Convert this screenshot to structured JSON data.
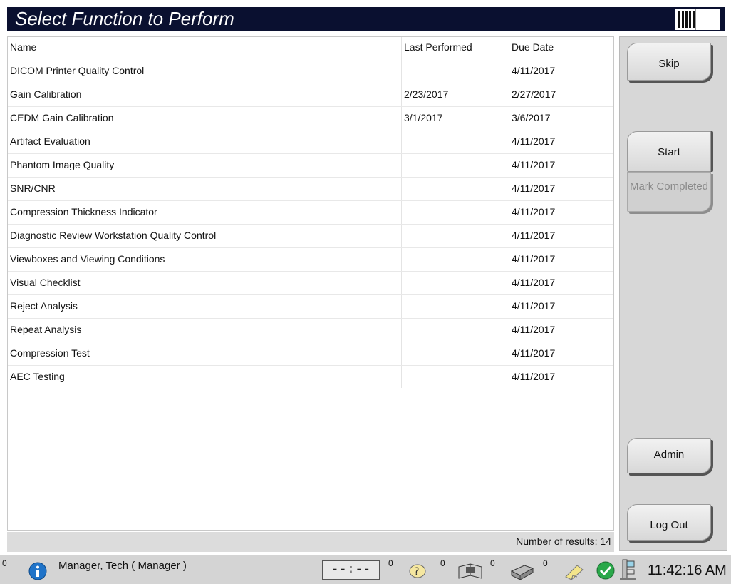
{
  "window": {
    "title": "Select Function to Perform"
  },
  "table": {
    "columns": [
      "Name",
      "Last Performed",
      "Due Date"
    ],
    "rows": [
      {
        "name": "DICOM Printer Quality Control",
        "last_performed": "",
        "due_date": "4/11/2017"
      },
      {
        "name": "Gain Calibration",
        "last_performed": "2/23/2017",
        "due_date": "2/27/2017"
      },
      {
        "name": "CEDM Gain Calibration",
        "last_performed": "3/1/2017",
        "due_date": "3/6/2017"
      },
      {
        "name": "Artifact Evaluation",
        "last_performed": "",
        "due_date": "4/11/2017"
      },
      {
        "name": "Phantom Image Quality",
        "last_performed": "",
        "due_date": "4/11/2017"
      },
      {
        "name": "SNR/CNR",
        "last_performed": "",
        "due_date": "4/11/2017"
      },
      {
        "name": "Compression Thickness Indicator",
        "last_performed": "",
        "due_date": "4/11/2017"
      },
      {
        "name": "Diagnostic Review Workstation Quality Control",
        "last_performed": "",
        "due_date": "4/11/2017"
      },
      {
        "name": "Viewboxes and Viewing Conditions",
        "last_performed": "",
        "due_date": "4/11/2017"
      },
      {
        "name": "Visual Checklist",
        "last_performed": "",
        "due_date": "4/11/2017"
      },
      {
        "name": "Reject Analysis",
        "last_performed": "",
        "due_date": "4/11/2017"
      },
      {
        "name": "Repeat Analysis",
        "last_performed": "",
        "due_date": "4/11/2017"
      },
      {
        "name": "Compression Test",
        "last_performed": "",
        "due_date": "4/11/2017"
      },
      {
        "name": "AEC Testing",
        "last_performed": "",
        "due_date": "4/11/2017"
      }
    ],
    "results_label": "Number of results: 14"
  },
  "buttons": {
    "skip": "Skip",
    "start": "Start",
    "mark_completed": "Mark Completed",
    "admin": "Admin",
    "logout": "Log Out"
  },
  "taskbar": {
    "info_count": "0",
    "user": "Manager, Tech ( Manager )",
    "timer": "--:--",
    "count_after_timer": "0",
    "count_after_help": "0",
    "count_after_book": "0",
    "count_after_printer": "0",
    "time": "11:42:16 AM",
    "icons": [
      "info-icon",
      "help-icon",
      "book-icon",
      "printer-icon",
      "note-icon",
      "check-icon",
      "device-icon"
    ]
  },
  "colors": {
    "title_bar": "#0a1030",
    "panel": "#d7d7d7",
    "info_blue": "#1f73c8",
    "check_green": "#2aa84a"
  }
}
